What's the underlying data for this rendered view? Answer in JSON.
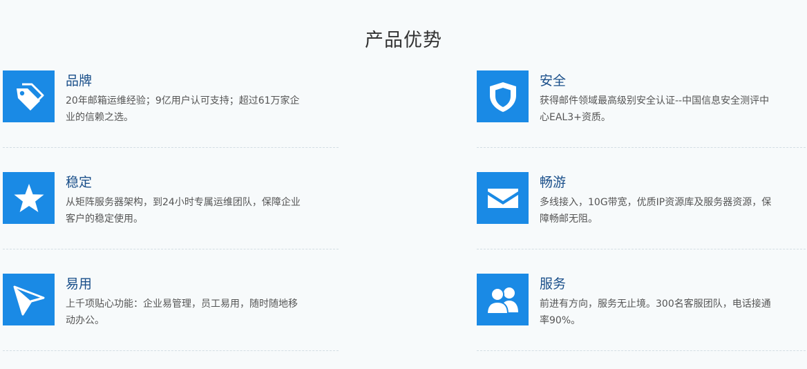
{
  "section": {
    "title": "产品优势"
  },
  "accent_color": "#1a8ae5",
  "features": [
    {
      "icon": "tag-icon",
      "title": "品牌",
      "desc": "20年邮箱运维经验；9亿用户认可支持；超过61万家企业的信赖之选。"
    },
    {
      "icon": "shield-icon",
      "title": "安全",
      "desc": "获得邮件领域最高级别安全认证--中国信息安全测评中心EAL3+资质。"
    },
    {
      "icon": "star-icon",
      "title": "稳定",
      "desc": "从矩阵服务器架构，到24小时专属运维团队，保障企业客户的稳定使用。"
    },
    {
      "icon": "envelope-icon",
      "title": "畅游",
      "desc": "多线接入，10G带宽，优质IP资源库及服务器资源，保障畅邮无阻。"
    },
    {
      "icon": "paper-plane-icon",
      "title": "易用",
      "desc": "上千项贴心功能：企业易管理，员工易用，随时随地移动办公。"
    },
    {
      "icon": "users-icon",
      "title": "服务",
      "desc": "前进有方向，服务无止境。300名客服团队，电话接通率90%。"
    }
  ]
}
